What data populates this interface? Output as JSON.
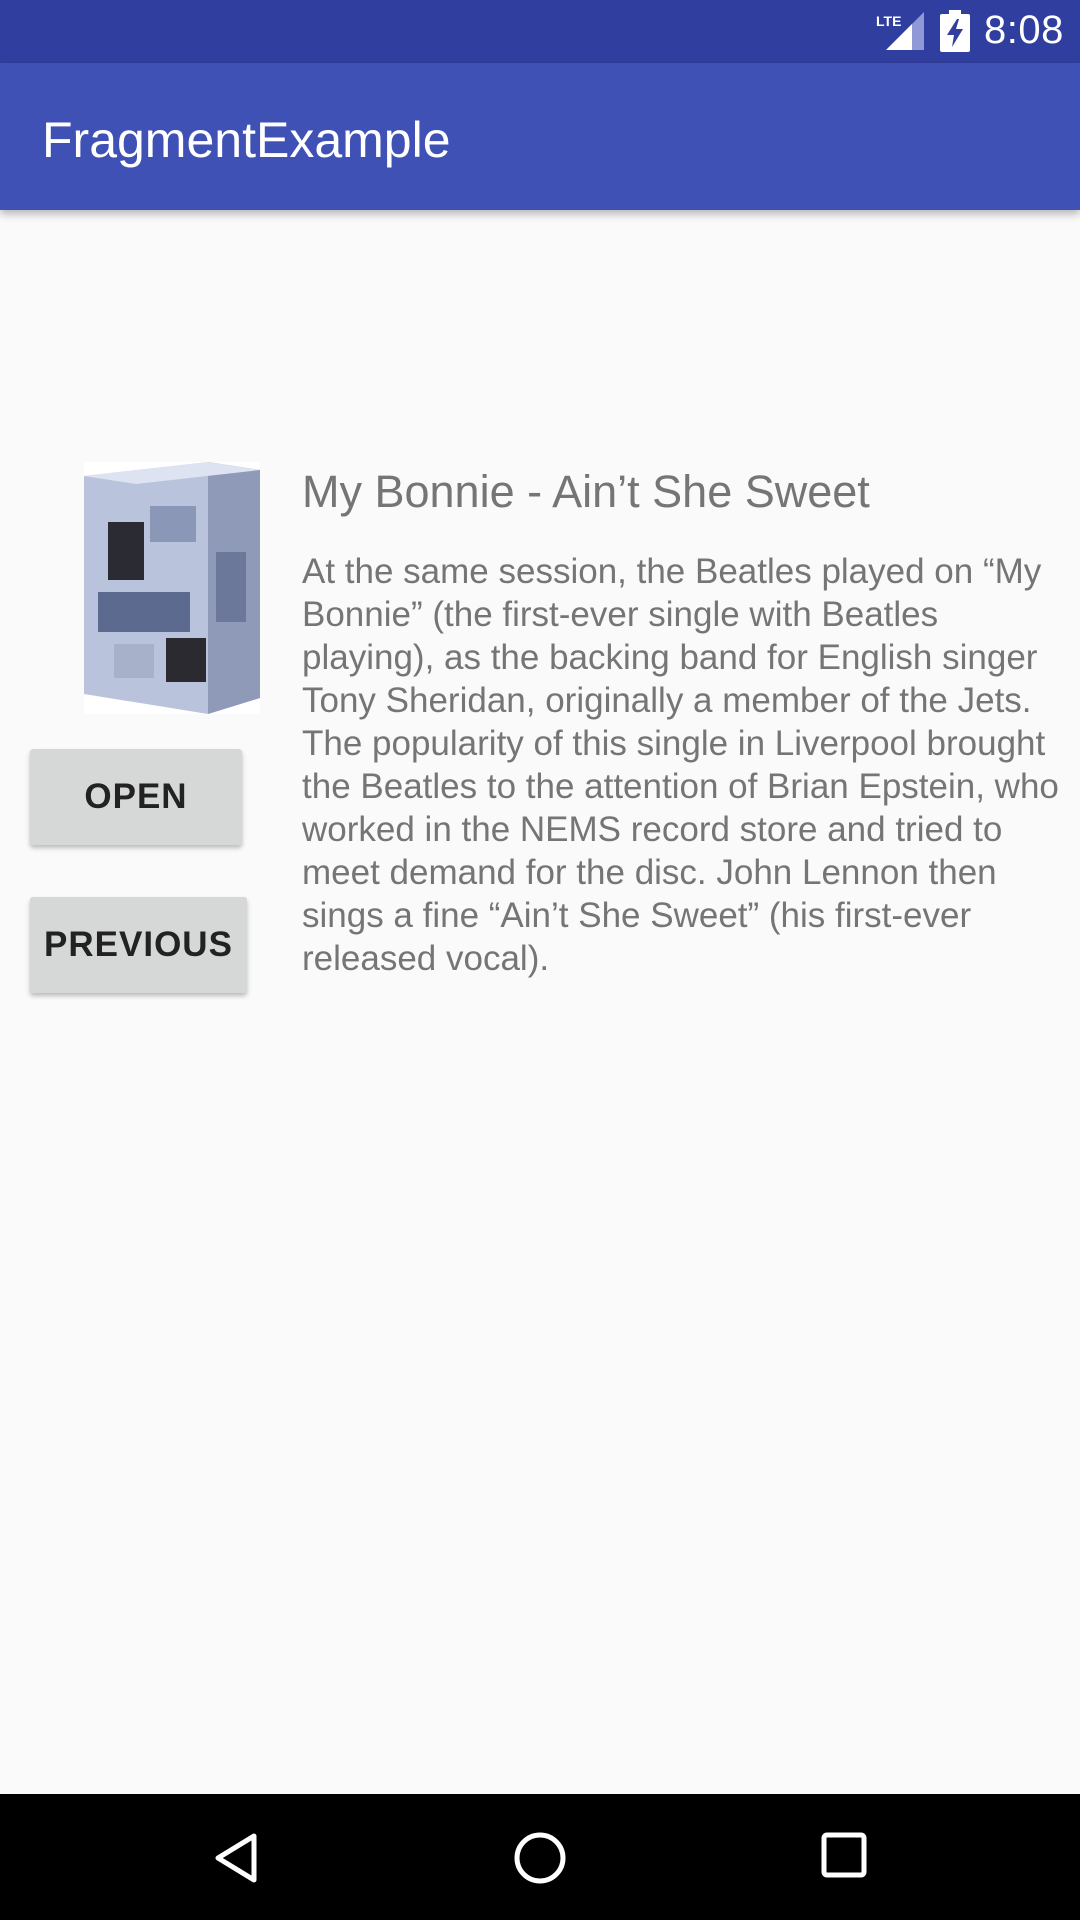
{
  "status_bar": {
    "network": "LTE",
    "time": "8:08",
    "icons": [
      "lte-signal-icon",
      "battery-charging-icon"
    ]
  },
  "app_bar": {
    "title": "FragmentExample"
  },
  "content": {
    "album_image": "album-cover",
    "buttons": {
      "open_label": "OPEN",
      "previous_label": "PREVIOUS"
    },
    "song": {
      "title": "My Bonnie - Ain’t She Sweet",
      "description": "At the same session, the Beatles played on “My Bonnie” (the first-ever single with Beatles playing), as the backing band for English singer Tony Sheridan, originally a member of the Jets. The popularity of this single in Liverpool brought the Beatles to the attention of Brian Epstein, who worked in the NEMS record store and tried to meet demand for the disc. John Lennon then sings a fine “Ain’t She Sweet” (his first-ever released vocal)."
    }
  },
  "nav_bar": {
    "icons": [
      "back-icon",
      "home-icon",
      "recents-icon"
    ]
  },
  "colors": {
    "status_bar": "#303f9f",
    "app_bar": "#3f51b5",
    "background": "#fafafa",
    "button": "#d6d7d7",
    "body_text": "#757575"
  }
}
